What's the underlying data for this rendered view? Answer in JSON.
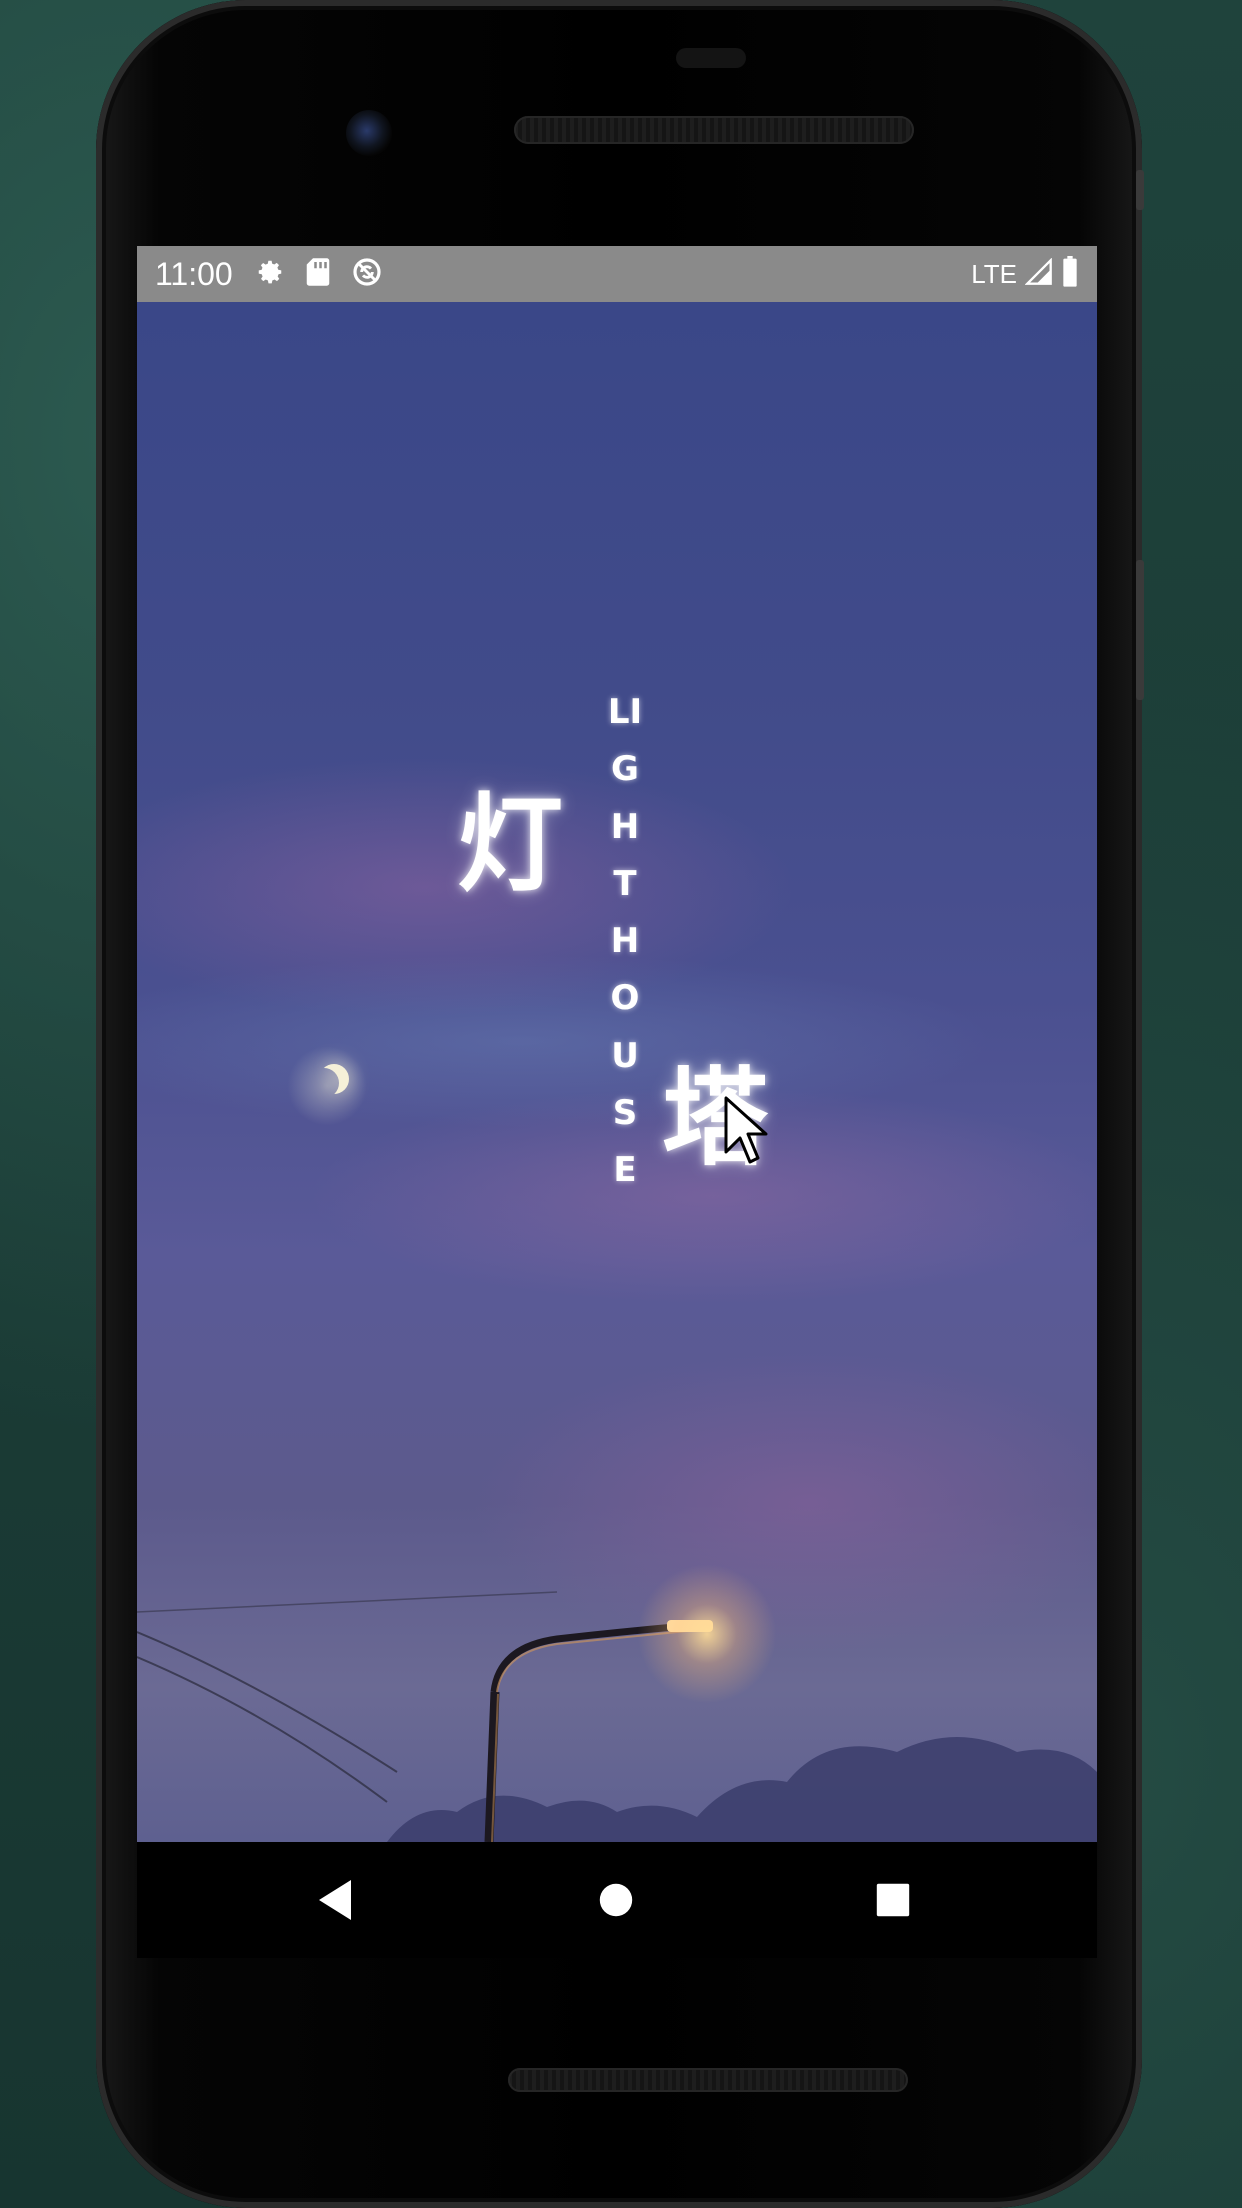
{
  "status_bar": {
    "time": "11:00",
    "network": "LTE",
    "icons_left": [
      "settings-icon",
      "sd-card-icon",
      "sync-icon"
    ],
    "icons_right": [
      "signal-icon",
      "battery-icon"
    ]
  },
  "splash": {
    "title_cn_1": "灯",
    "title_cn_2": "塔",
    "title_en": "LIGHTHOUSE"
  },
  "nav_bar": {
    "buttons": [
      "back-icon",
      "home-icon",
      "recents-icon"
    ]
  },
  "colors": {
    "status_bar_bg": "#8a8a8a",
    "sky_top": "#3a4788",
    "sky_bottom": "#6b6a94",
    "lamp_light": "#ffd79a"
  }
}
